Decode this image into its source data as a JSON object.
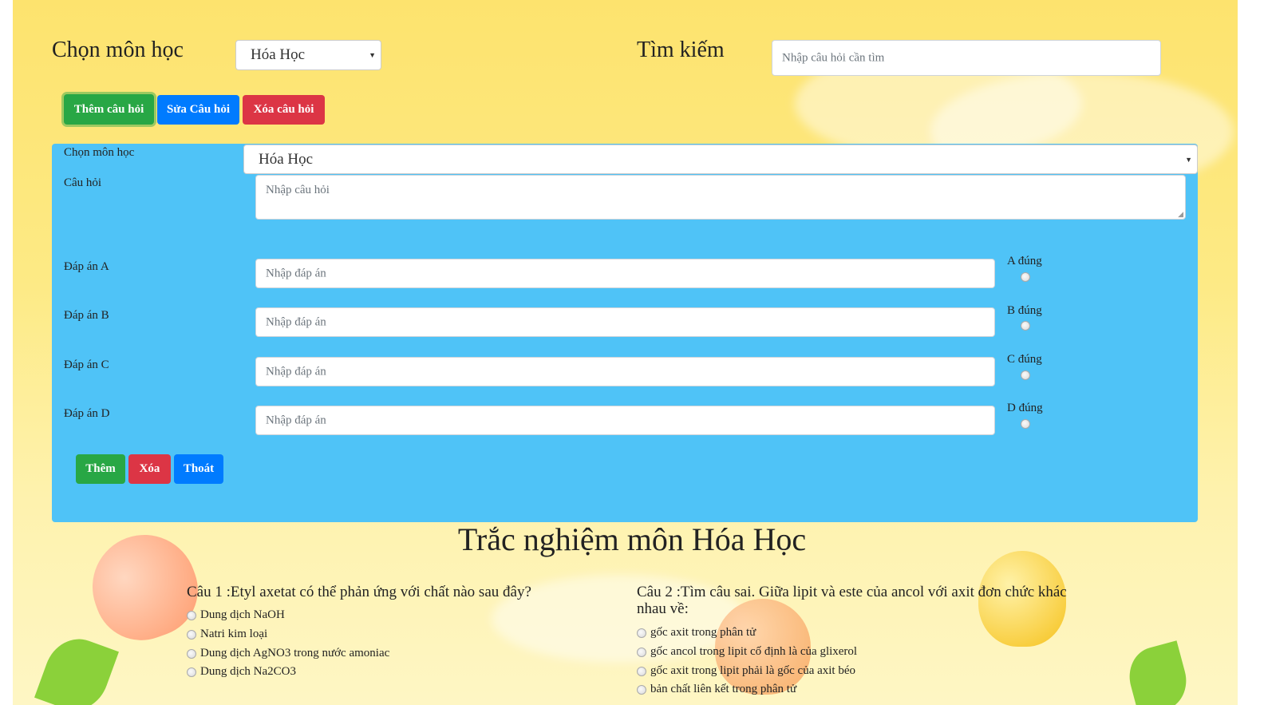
{
  "header": {
    "subject_label": "Chọn môn học",
    "subject_value": "Hóa Học",
    "search_label": "Tìm kiếm",
    "search_placeholder": "Nhập câu hỏi cần tìm"
  },
  "toolbar": {
    "add_label": "Thêm câu hỏi",
    "edit_label": "Sửa Câu hỏi",
    "delete_label": "Xóa câu hỏi"
  },
  "form": {
    "subject_label": "Chọn môn học",
    "subject_value": "Hóa Học",
    "question_label": "Câu hỏi",
    "question_placeholder": "Nhập câu hỏi",
    "answers": [
      {
        "label": "Đáp án A",
        "placeholder": "Nhập đáp án",
        "correct_label": "A đúng"
      },
      {
        "label": "Đáp án B",
        "placeholder": "Nhập đáp án",
        "correct_label": "B đúng"
      },
      {
        "label": "Đáp án C",
        "placeholder": "Nhập đáp án",
        "correct_label": "C đúng"
      },
      {
        "label": "Đáp án D",
        "placeholder": "Nhập đáp án",
        "correct_label": "D đúng"
      }
    ],
    "buttons": {
      "add": "Thêm",
      "delete": "Xóa",
      "exit": "Thoát"
    }
  },
  "quiz": {
    "title": "Trắc nghiệm môn Hóa Học",
    "questions": [
      {
        "text": "Câu 1 :Etyl axetat có thể phản ứng với chất nào sau đây?",
        "options": [
          "Dung dịch NaOH",
          "Natri kim loại",
          "Dung dịch AgNO3 trong nước amoniac",
          "Dung dịch Na2CO3"
        ]
      },
      {
        "text": "Câu 2 :Tìm câu sai. Giữa lipit và este của ancol với axit đơn chức khác nhau về:",
        "options": [
          "gốc axit trong phân tử",
          "gốc ancol trong lipit cố định là của glixerol",
          "gốc axit trong lipit phải là gốc của axit béo",
          "bản chất liên kết trong phân tử"
        ]
      }
    ]
  },
  "colors": {
    "panel": "#4fc3f7",
    "green": "#28a745",
    "blue": "#007bff",
    "red": "#dc3545",
    "background": "#fde36e"
  }
}
